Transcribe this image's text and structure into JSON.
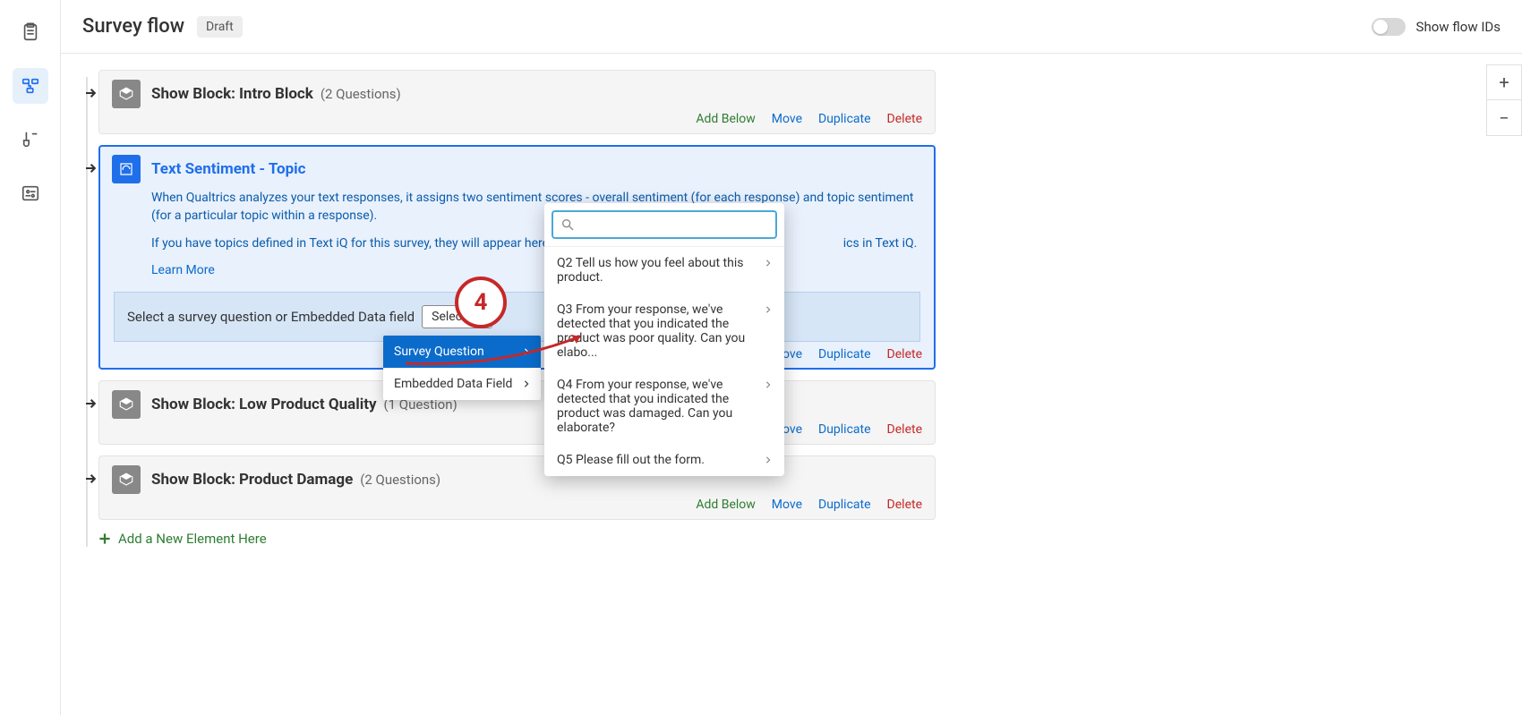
{
  "header": {
    "title": "Survey flow",
    "badge": "Draft",
    "toggle_label": "Show flow IDs"
  },
  "flow": {
    "block1": {
      "prefix": "Show Block:",
      "name": "Intro Block",
      "meta": "(2 Questions)"
    },
    "sentiment": {
      "title": "Text Sentiment - Topic",
      "p1": "When Qualtrics analyzes your text responses, it assigns two sentiment scores - overall sentiment (for each response) and topic sentiment (for a particular topic within a response).",
      "p2_a": "If you have topics defined in Text iQ for this survey, they will appear here; however, ",
      "p2_b": "ics in Text iQ.",
      "learn": "Learn More",
      "select_label": "Select a survey question or Embedded Data field",
      "select_value": "Select",
      "menu": {
        "opt1": "Survey Question",
        "opt2": "Embedded Data Field"
      }
    },
    "qpop": {
      "items": [
        "Q2 Tell us how you feel about this product.",
        "Q3 From your response, we've detected that you indicated the product was poor quality. Can you elabo...",
        "Q4 From your response, we've detected that you indicated the product was damaged. Can you elaborate?",
        "Q5 Please fill out the form."
      ]
    },
    "block2": {
      "prefix": "Show Block:",
      "name": "Low Product Quality",
      "meta": "(1 Question)"
    },
    "block3": {
      "prefix": "Show Block:",
      "name": "Product Damage",
      "meta": "(2 Questions)"
    },
    "add_new": "Add a New Element Here"
  },
  "actions": {
    "add": "Add Below",
    "move": "Move",
    "dup": "Duplicate",
    "del": "Delete"
  },
  "callout": "4"
}
